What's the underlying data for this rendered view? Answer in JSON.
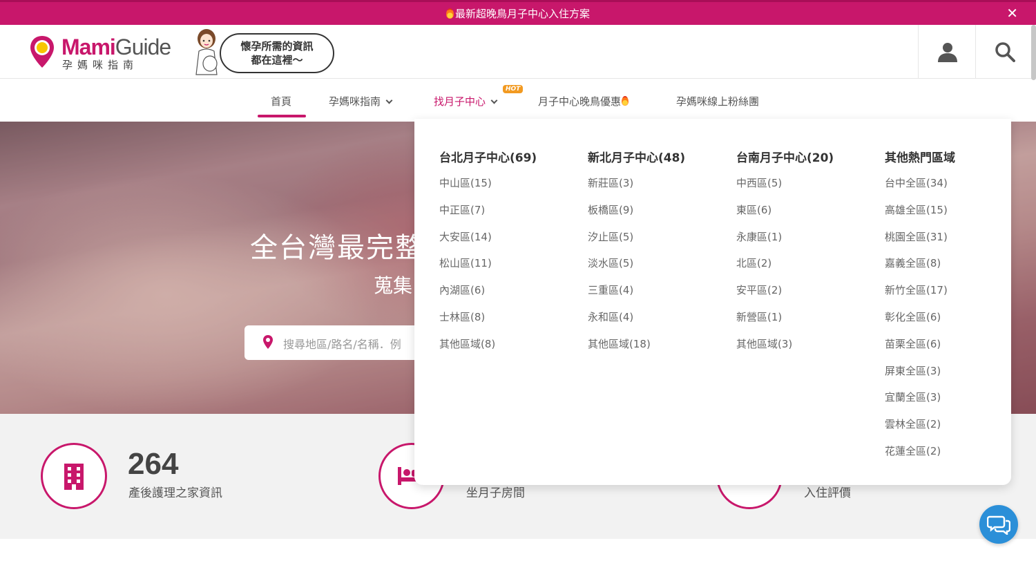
{
  "promo": {
    "text": "最新超晚鳥月子中心入住方案",
    "close": "✕"
  },
  "header": {
    "brand_part1": "Mami",
    "brand_part2": "Guide",
    "brand_sub": "孕媽咪指南",
    "bubble_line1": "懷孕所需的資訊",
    "bubble_line2": "都在這裡～"
  },
  "nav": {
    "items": [
      {
        "label": "首頁"
      },
      {
        "label": "孕媽咪指南"
      },
      {
        "label": "找月子中心"
      },
      {
        "label": "月子中心晚鳥優惠"
      },
      {
        "label": "孕媽咪線上粉絲團"
      }
    ],
    "hot_badge": "HOT"
  },
  "hero": {
    "title": "全台灣最完整",
    "subtitle": "蒐集",
    "search_placeholder": "搜尋地區/路名/名稱．例"
  },
  "stats": [
    {
      "number": "264",
      "label": "產後護理之家資訊"
    },
    {
      "number": "",
      "label": "坐月子房間"
    },
    {
      "number": "",
      "label": "入住評價"
    }
  ],
  "mega": {
    "columns": [
      {
        "title": "台北月子中心(69)",
        "items": [
          "中山區(15)",
          "中正區(7)",
          "大安區(14)",
          "松山區(11)",
          "內湖區(6)",
          "士林區(8)",
          "其他區域(8)"
        ]
      },
      {
        "title": "新北月子中心(48)",
        "items": [
          "新莊區(3)",
          "板橋區(9)",
          "汐止區(5)",
          "淡水區(5)",
          "三重區(4)",
          "永和區(4)",
          "其他區域(18)"
        ]
      },
      {
        "title": "台南月子中心(20)",
        "items": [
          "中西區(5)",
          "東區(6)",
          "永康區(1)",
          "北區(2)",
          "安平區(2)",
          "新營區(1)",
          "其他區域(3)"
        ]
      },
      {
        "title": "其他熱門區域",
        "items": [
          "台中全區(34)",
          "高雄全區(15)",
          "桃園全區(31)",
          "嘉義全區(8)",
          "新竹全區(17)",
          "彰化全區(6)",
          "苗栗全區(6)",
          "屏東全區(3)",
          "宜蘭全區(3)",
          "雲林全區(2)",
          "花蓮全區(2)"
        ]
      }
    ]
  },
  "colors": {
    "brand": "#c8176b",
    "hot": "#f29a21",
    "chat": "#2b8fd8"
  }
}
